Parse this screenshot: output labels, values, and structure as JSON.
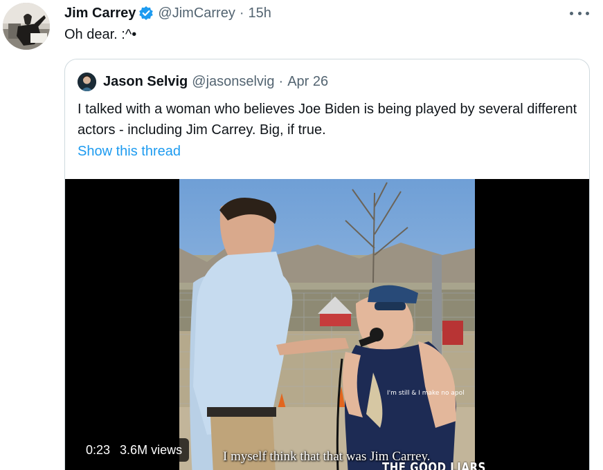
{
  "tweet": {
    "author_name": "Jim Carrey",
    "handle": "@JimCarrey",
    "separator": "·",
    "time": "15h",
    "text": "Oh dear. :^•",
    "verified_color": "#1d9bf0"
  },
  "quoted_tweet": {
    "author_name": "Jason Selvig",
    "handle": "@jasonselvig",
    "separator": "·",
    "date": "Apr 26",
    "text": "I talked with a woman who believes Joe Biden is being played by several different actors - including Jim Carrey. Big, if true.",
    "show_thread_label": "Show this thread",
    "link_color": "#1d9bf0"
  },
  "video": {
    "duration": "0:23",
    "views": "3.6M views",
    "caption": "I myself think that that was Jim Carrey.",
    "watermark": "THE GOOD  LIARS",
    "shirt_text": "I'm still & I make no apol"
  },
  "icons": {
    "verified": "verified-badge-icon",
    "more": "more-options-icon"
  }
}
